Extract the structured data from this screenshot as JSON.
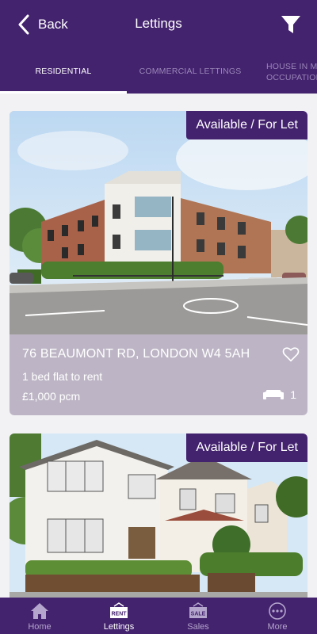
{
  "header": {
    "back_label": "Back",
    "title": "Lettings"
  },
  "tabs": [
    {
      "label": "RESIDENTIAL",
      "active": true
    },
    {
      "label": "COMMERCIAL LETTINGS",
      "active": false
    },
    {
      "label": "HOUSE IN MULTIPLE OCCUPATION",
      "active": false
    }
  ],
  "listings": [
    {
      "badge": "Available / For Let",
      "address": "76 BEAUMONT RD, LONDON W4 5AH",
      "description": "1 bed flat to rent",
      "price": "£1,000 pcm",
      "bedrooms": "1"
    },
    {
      "badge": "Available / For Let"
    }
  ],
  "bottom_nav": [
    {
      "label": "Home",
      "icon": "home-icon",
      "active": false
    },
    {
      "label": "Lettings",
      "icon": "rent-sign-icon",
      "active": true
    },
    {
      "label": "Sales",
      "icon": "sale-sign-icon",
      "active": false
    },
    {
      "label": "More",
      "icon": "more-icon",
      "active": false
    }
  ],
  "colors": {
    "brand": "#43226e",
    "card": "#bdb5c5",
    "background": "#f2f1f4"
  }
}
